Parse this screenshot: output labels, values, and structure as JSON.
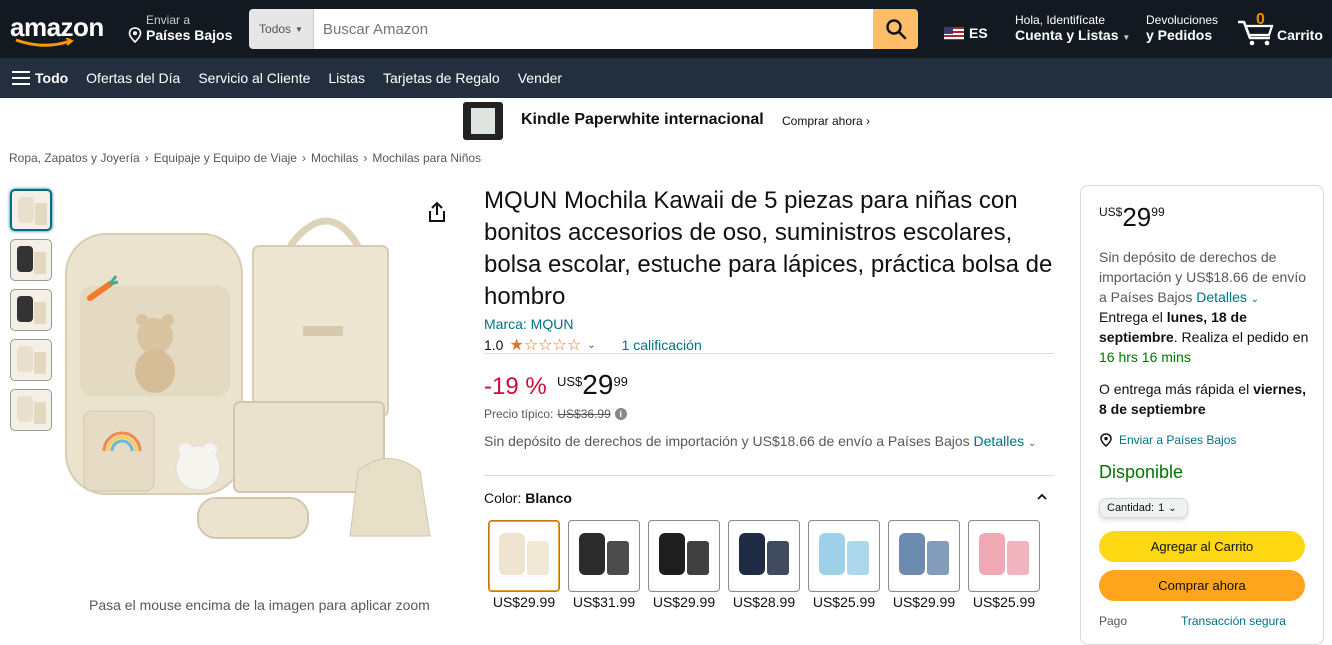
{
  "header": {
    "logo_text": "amazon",
    "deliver_small": "Enviar a",
    "deliver_big": "Países Bajos",
    "search_category": "Todos",
    "search_placeholder": "Buscar Amazon",
    "language": "ES",
    "account_small": "Hola, Identifícate",
    "account_big": "Cuenta y Listas",
    "returns_small": "Devoluciones",
    "returns_big": "y Pedidos",
    "cart_count": "0",
    "cart_label": "Carrito"
  },
  "nav": {
    "all_label": "Todo",
    "items": [
      "Ofertas del Día",
      "Servicio al Cliente",
      "Listas",
      "Tarjetas de Regalo",
      "Vender"
    ]
  },
  "banner": {
    "title": "Kindle Paperwhite internacional",
    "cta": "Comprar ahora ›"
  },
  "breadcrumb": [
    "Ropa, Zapatos y Joyería",
    "Equipaje y Equipo de Viaje",
    "Mochilas",
    "Mochilas para Niños"
  ],
  "gallery": {
    "zoom_hint": "Pasa el mouse encima de la imagen para aplicar zoom"
  },
  "product": {
    "title": "MQUN Mochila Kawaii de 5 piezas para niñas con bonitos accesorios de oso, suministros escolares, bolsa escolar, estuche para lápices, práctica bolsa de hombro",
    "brand": "Marca: MQUN",
    "rating_value": "1.0",
    "rating_stars": 1,
    "rating_count": "1 calificación",
    "discount": "-19 %",
    "price_currency": "US$",
    "price_whole": "29",
    "price_fraction": "99",
    "list_price_label": "Precio típico:",
    "list_price": "US$36.99",
    "import_text": "Sin depósito de derechos de importación y US$18.66 de envío a Países Bajos",
    "import_link": "Detalles",
    "color_label": "Color:",
    "color_value": "Blanco",
    "swatch_prices": [
      "US$29.99",
      "US$31.99",
      "US$29.99",
      "US$28.99",
      "US$25.99",
      "US$29.99",
      "US$25.99"
    ],
    "swatch_colors": [
      "#eee4cf",
      "#2b2b2b",
      "#1e1e1e",
      "#1f2b44",
      "#9fd0ea",
      "#6d8bb0",
      "#f0a8b4"
    ]
  },
  "buybox": {
    "price_currency": "US$",
    "price_whole": "29",
    "price_fraction": "99",
    "import_text": "Sin depósito de derechos de importación y US$18.66 de envío a Países Bajos",
    "import_link": "Detalles",
    "delivery_prefix": "Entrega el",
    "delivery_date": "lunes, 18 de septiembre",
    "delivery_mid": ". Realiza el pedido en",
    "delivery_countdown": "16 hrs 16 mins",
    "fast_prefix": "O entrega más rápida el",
    "fast_date": "viernes, 8 de septiembre",
    "location": "Enviar a Países Bajos",
    "availability": "Disponible",
    "quantity_label": "Cantidad:",
    "quantity_value": "1",
    "add_to_cart": "Agregar al Carrito",
    "buy_now": "Comprar ahora",
    "footer_left": "Pago",
    "footer_right": "Transacción segura"
  },
  "colors": {
    "nav_top": "#131921",
    "nav_bottom": "#232f3e",
    "search_button": "#febd69",
    "link": "#007185",
    "discount": "#cc0c39",
    "in_stock": "#007600",
    "cart_button": "#ffd814",
    "buy_button": "#ffa41c",
    "star": "#de7921"
  }
}
